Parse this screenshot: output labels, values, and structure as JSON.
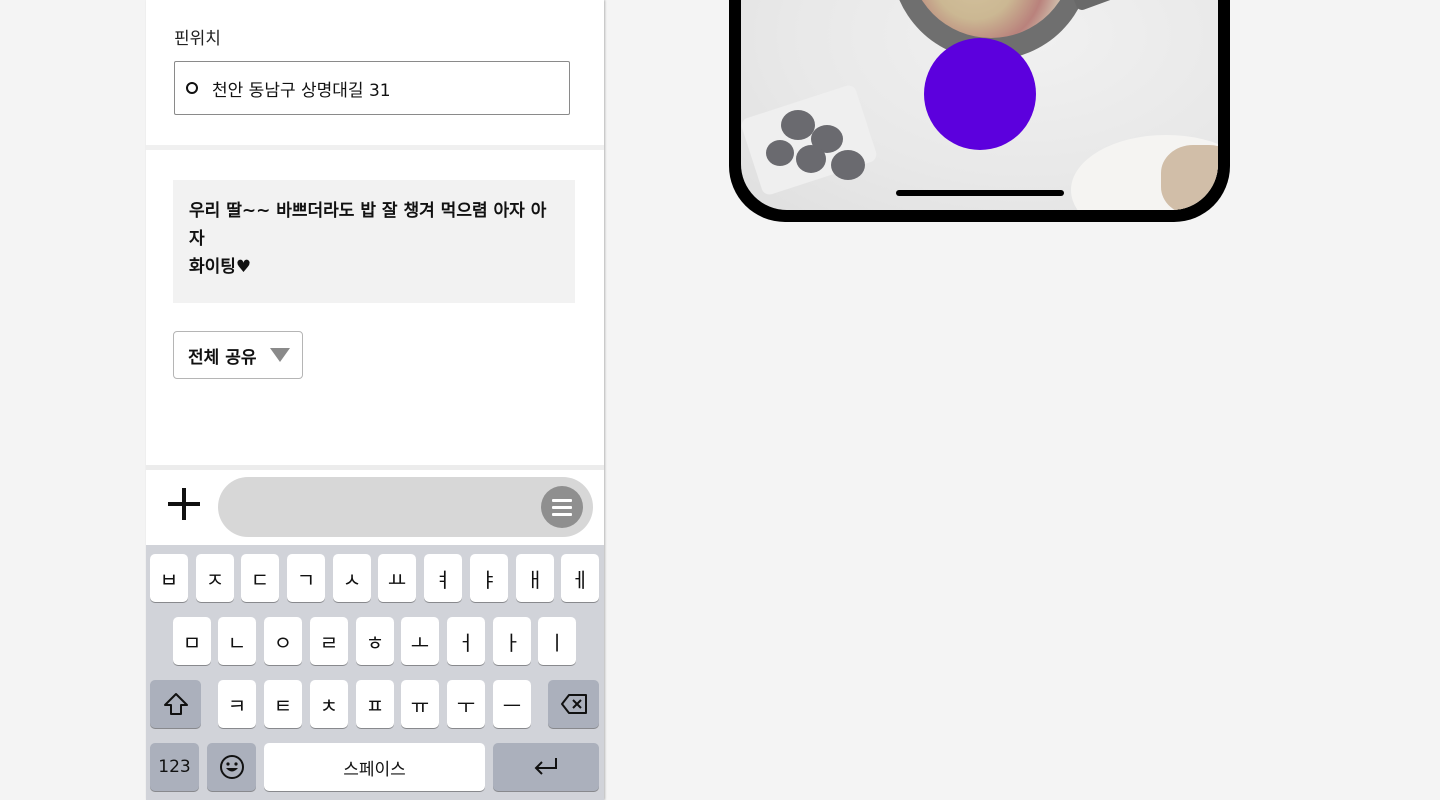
{
  "location": {
    "label": "핀위치",
    "address": "천안 동남구 상명대길 31"
  },
  "memo": {
    "line1": "우리 딸~~ 바쁘더라도 밥 잘 챙겨 먹으렴 아자 아자",
    "line2": "화이팅♥"
  },
  "share": {
    "selected": "전체 공유"
  },
  "composer": {
    "input_value": ""
  },
  "keyboard": {
    "row1": [
      "ㅂ",
      "ㅈ",
      "ㄷ",
      "ㄱ",
      "ㅅ",
      "ㅛ",
      "ㅕ",
      "ㅑ",
      "ㅐ",
      "ㅔ"
    ],
    "row2": [
      "ㅁ",
      "ㄴ",
      "ㅇ",
      "ㄹ",
      "ㅎ",
      "ㅗ",
      "ㅓ",
      "ㅏ",
      "ㅣ"
    ],
    "row3": [
      "ㅋ",
      "ㅌ",
      "ㅊ",
      "ㅍ",
      "ㅠ",
      "ㅜ",
      "ㅡ"
    ],
    "numbers_label": "123",
    "space_label": "스페이스"
  },
  "colors": {
    "accent_circle": "#5c00dd",
    "keyboard_bg": "#d1d3d9"
  }
}
